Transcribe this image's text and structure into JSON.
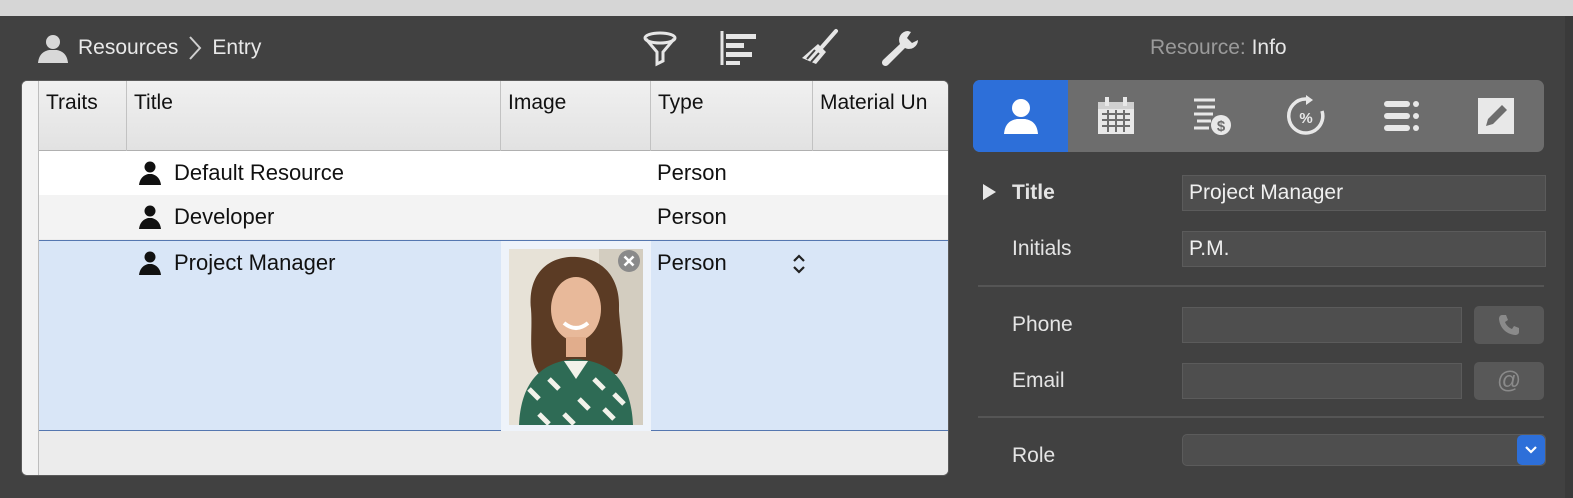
{
  "breadcrumb": {
    "root": "Resources",
    "current": "Entry"
  },
  "toolbar": {
    "icons": [
      "filter-icon",
      "gantt-icon",
      "brush-icon",
      "wrench-icon"
    ]
  },
  "inspector": {
    "title_prefix": "Resource:",
    "title_value": "Info"
  },
  "table": {
    "columns": [
      "Traits",
      "Title",
      "Image",
      "Type",
      "Material Un"
    ],
    "rows": [
      {
        "title": "Default Resource",
        "type": "Person",
        "has_image": false
      },
      {
        "title": "Developer",
        "type": "Person",
        "has_image": false
      },
      {
        "title": "Project Manager",
        "type": "Person",
        "has_image": true,
        "selected": true
      }
    ]
  },
  "inspector_tabs": [
    "person-icon",
    "calendar-icon",
    "cost-icon",
    "percent-cycle-icon",
    "list-icon",
    "edit-icon"
  ],
  "fields": {
    "title_label": "Title",
    "title_value": "Project Manager",
    "initials_label": "Initials",
    "initials_value": "P.M.",
    "phone_label": "Phone",
    "phone_value": "",
    "email_label": "Email",
    "email_value": "",
    "email_button": "@",
    "role_label": "Role",
    "role_value": ""
  },
  "colors": {
    "accent": "#2d6fd9",
    "selection": "#d9e6f7",
    "window_bg": "#414141"
  }
}
